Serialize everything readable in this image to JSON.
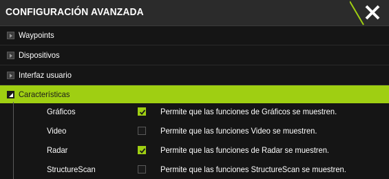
{
  "header": {
    "title": "CONFIGURACIÓN AVANZADA"
  },
  "tree": [
    {
      "label": "Waypoints",
      "expanded": false
    },
    {
      "label": "Dispositivos",
      "expanded": false
    },
    {
      "label": "Interfaz usuario",
      "expanded": false
    },
    {
      "label": "Características",
      "expanded": true
    }
  ],
  "features": [
    {
      "name": "Gráficos",
      "checked": true,
      "description": "Permite que las funciones de Gráficos se muestren."
    },
    {
      "name": "Video",
      "checked": false,
      "description": "Permite que las funciones Video se muestren."
    },
    {
      "name": "Radar",
      "checked": true,
      "description": "Permite que las funciones de Radar se muestren."
    },
    {
      "name": "StructureScan",
      "checked": false,
      "description": "Permite que las funciones StructureScan se muestren."
    }
  ],
  "colors": {
    "accent": "#9fcf12",
    "background": "#151515",
    "header": "#2b2b2b"
  }
}
